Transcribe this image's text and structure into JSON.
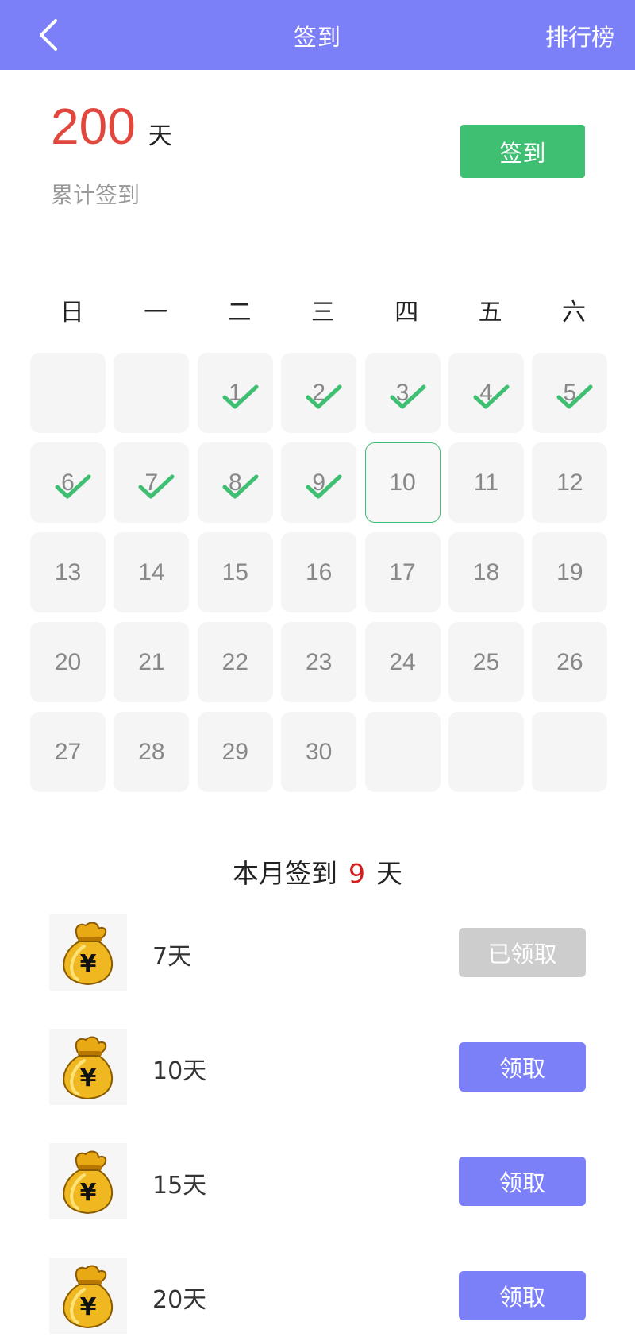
{
  "header": {
    "title": "签到",
    "right_link": "排行榜"
  },
  "summary": {
    "total_days": "200",
    "unit": "天",
    "label": "累计签到",
    "checkin_button": "签到"
  },
  "calendar": {
    "weekdays": [
      "日",
      "一",
      "二",
      "三",
      "四",
      "五",
      "六"
    ],
    "leading_blanks": 2,
    "days_in_month": 30,
    "signed_days": [
      1,
      2,
      3,
      4,
      5,
      6,
      7,
      8,
      9
    ],
    "today": 10,
    "accent_color": "#3ebf72"
  },
  "month_summary": {
    "prefix": "本月签到",
    "count": "9",
    "suffix": "天"
  },
  "rewards": [
    {
      "label": "7天",
      "button": "已领取",
      "claimed": true
    },
    {
      "label": "10天",
      "button": "领取",
      "claimed": false
    },
    {
      "label": "15天",
      "button": "领取",
      "claimed": false
    },
    {
      "label": "20天",
      "button": "领取",
      "claimed": false
    }
  ],
  "colors": {
    "header": "#7b80f9",
    "checkin": "#3ebf72",
    "highlight": "#e2473d"
  }
}
